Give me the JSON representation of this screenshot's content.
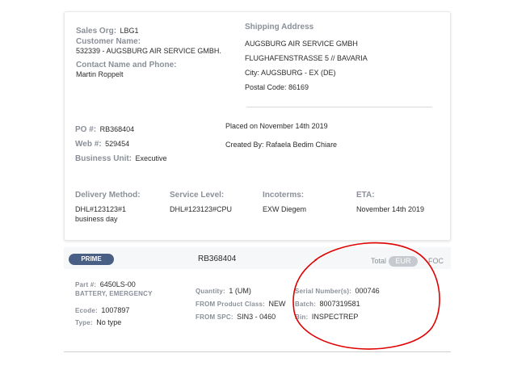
{
  "order": {
    "sales_org_label": "Sales Org:",
    "sales_org_value": "LBG1",
    "customer_name_label": "Customer Name:",
    "customer_name_value": "532339 - AUGSBURG AIR SERVICE GMBH.",
    "contact_label": "Contact Name and Phone:",
    "contact_value": "Martin Roppelt",
    "shipping_label": "Shipping Address",
    "shipping_lines": [
      "AUGSBURG AIR SERVICE GMBH",
      "FLUGHAFENSTRASSE 5 // BAVARIA",
      "City: AUGSBURG - EX (DE)",
      "Postal Code: 86169"
    ],
    "po_label": "PO #:",
    "po_value": "RB368404",
    "web_label": "Web #:",
    "web_value": "529454",
    "bu_label": "Business Unit:",
    "bu_value": "Executive",
    "placed_on": "Placed on November 14th 2019",
    "created_by": "Created By: Rafaela Bedim Chiare",
    "delivery_method_label": "Delivery Method:",
    "delivery_method_value_line1": "DHL#123123#1",
    "delivery_method_value_line2": "business day",
    "service_level_label": "Service Level:",
    "service_level_value": "DHL#123123#CPU",
    "incoterms_label": "Incoterms:",
    "incoterms_value": "EXW Diegem",
    "eta_label": "ETA:",
    "eta_value": "November 14th 2019"
  },
  "line_item": {
    "badge": "PRIME",
    "order_ref": "RB368404",
    "total_label": "Total",
    "currency_eur": "EUR",
    "currency_foc": "FOC",
    "part_label": "Part #:",
    "part_value": "6450LS-00",
    "description": "BATTERY, EMERGENCY",
    "ecode_label": "Ecode:",
    "ecode_value": "1007897",
    "type_label": "Type:",
    "type_value": "No type",
    "quantity_label": "Quantity:",
    "quantity_value": "1 (UM)",
    "from_class_label": "FROM Product Class:",
    "from_class_value": "NEW",
    "from_spc_label": "FROM SPC:",
    "from_spc_value": "SIN3 - 0460",
    "serial_label": "Serial Number(s):",
    "serial_value": "000746",
    "batch_label": "Batch:",
    "batch_value": "8007319581",
    "bin_label": "Bin:",
    "bin_value": "INSPECTREP"
  },
  "colors": {
    "badge": "#4a5f86",
    "annotation": "#e00000"
  }
}
